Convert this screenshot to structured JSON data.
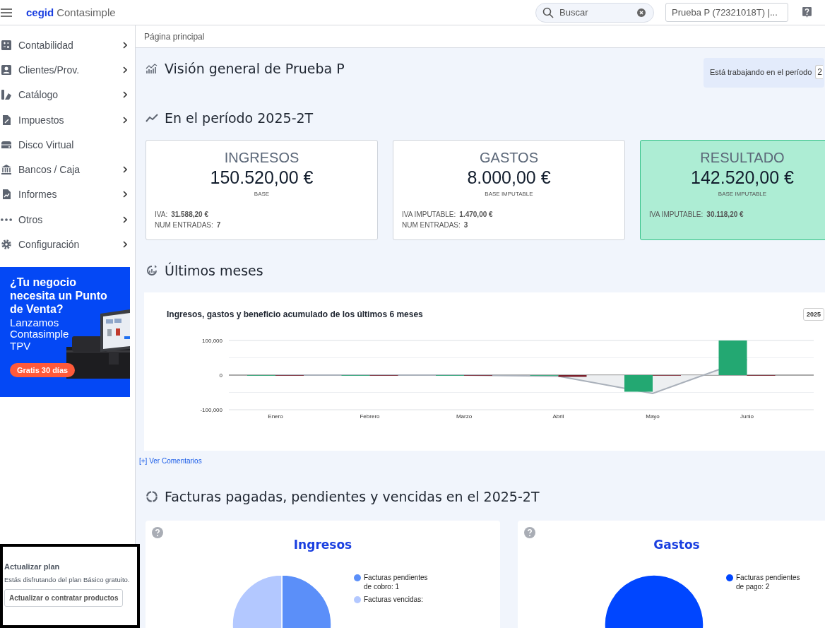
{
  "header": {
    "logo_brand": "cegid",
    "logo_product": "Contasimple",
    "search": {
      "placeholder": "Buscar"
    },
    "company": "Prueba P (72321018T) |..."
  },
  "sidebar": {
    "items": [
      {
        "label": "Contabilidad",
        "has_submenu": true
      },
      {
        "label": "Clientes/Prov.",
        "has_submenu": true
      },
      {
        "label": "Catálogo",
        "has_submenu": true
      },
      {
        "label": "Impuestos",
        "has_submenu": true
      },
      {
        "label": "Disco Virtual",
        "has_submenu": false
      },
      {
        "label": "Bancos / Caja",
        "has_submenu": true
      },
      {
        "label": "Informes",
        "has_submenu": true
      },
      {
        "label": "Otros",
        "has_submenu": true
      },
      {
        "label": "Configuración",
        "has_submenu": true
      }
    ],
    "banner": {
      "headline": "¿Tu negocio necesita un Punto de Venta?",
      "text": "Lanzamos Contasimple TPV",
      "button": "Gratis 30 días"
    },
    "upgrade": {
      "title": "Actualizar plan",
      "text": "Estás disfrutando del plan Básico gratuito.",
      "button": "Actualizar o contratar productos"
    }
  },
  "breadcrumb": "Página principal",
  "overview": {
    "title": "Visión general de Prueba P",
    "period_label": "Está trabajando en el período",
    "period_value": "2"
  },
  "period": {
    "title": "En el período 2025-2T",
    "cards": [
      {
        "title": "INGRESOS",
        "amount": "150.520,00 €",
        "amount_label": "BASE",
        "highlighted": false,
        "details": [
          {
            "label": "IVA:",
            "value": "31.588,20 €"
          },
          {
            "label": "NUM ENTRADAS:",
            "value": "7"
          }
        ]
      },
      {
        "title": "GASTOS",
        "amount": "8.000,00 €",
        "amount_label": "BASE IMPUTABLE",
        "highlighted": false,
        "details": [
          {
            "label": "IVA IMPUTABLE:",
            "value": "1.470,00 €"
          },
          {
            "label": "NUM ENTRADAS:",
            "value": "3"
          }
        ]
      },
      {
        "title": "RESULTADO",
        "amount": "142.520,00 €",
        "amount_label": "BASE IMPUTABLE",
        "highlighted": true,
        "details": [
          {
            "label": "IVA IMPUTABLE:",
            "value": "30.118,20 €"
          }
        ]
      }
    ]
  },
  "months": {
    "title": "Últimos meses",
    "year_button": "2025",
    "comments_link": "[+] Ver Comentarios",
    "chart_data": {
      "type": "bar",
      "title": "Ingresos, gastos y beneficio acumulado de los últimos 6 meses",
      "categories": [
        "Enero",
        "Febrero",
        "Marzo",
        "Abril",
        "Mayo",
        "Junio"
      ],
      "ylim": [
        -100000,
        100000
      ],
      "yticks": [
        {
          "value": -100000,
          "label": "-100,000"
        },
        {
          "value": 0,
          "label": "0"
        },
        {
          "value": 100000,
          "label": "100,000"
        }
      ],
      "series": [
        {
          "type": "bar",
          "color": "#23a872",
          "values": [
            0,
            0,
            0,
            0,
            -48000,
            100000
          ]
        },
        {
          "type": "bar",
          "color": "#7a1f2b",
          "values": [
            0,
            0,
            0,
            -5000,
            0,
            -1000
          ]
        },
        {
          "type": "line",
          "color": "#a9b0ba",
          "values": [
            0,
            0,
            0,
            -3000,
            -53000,
            45000
          ]
        }
      ],
      "stacked": false,
      "ref_lines": [
        {
          "axis": "y",
          "value": -50000
        },
        {
          "axis": "y",
          "value": 50000
        }
      ]
    }
  },
  "invoices": {
    "title": "Facturas pagadas, pendientes y vencidas en el 2025-2T",
    "panels": [
      {
        "title": "Ingresos",
        "chart_data": {
          "type": "pie",
          "values": [
            50,
            50
          ]
        },
        "legend": [
          {
            "label": "Facturas pendientes de cobro: 1",
            "color": "#5b8ff9"
          },
          {
            "label": "Facturas vencidas:",
            "color": "#b3c8ff"
          }
        ]
      },
      {
        "title": "Gastos",
        "chart_data": {
          "type": "pie",
          "values": [
            100
          ]
        },
        "legend": [
          {
            "label": "Facturas pendientes de pago: 2",
            "color": "#0046ff"
          }
        ]
      }
    ]
  }
}
